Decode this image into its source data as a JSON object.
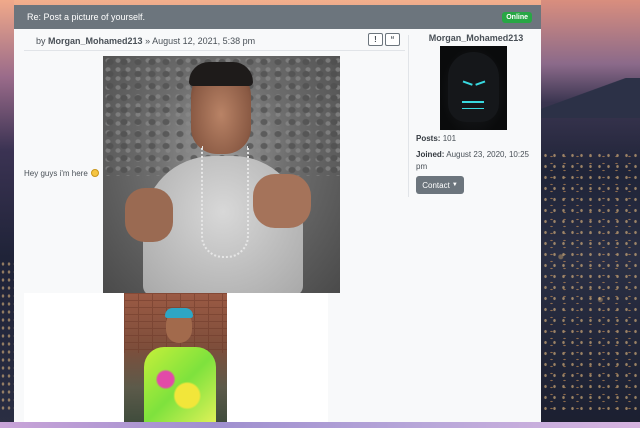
{
  "topic": {
    "title": "Re: Post a picture of yourself.",
    "status_badge": "Online"
  },
  "post": {
    "meta_prefix": "by",
    "author": "Morgan_Mohamed213",
    "meta_date": "» August 12, 2021, 5:38 pm",
    "report_label": "!",
    "quote_label": "“",
    "body_text": "Hey guys i'm here"
  },
  "profile": {
    "username": "Morgan_Mohamed213",
    "posts_label": "Posts:",
    "posts_value": "101",
    "joined_label": "Joined:",
    "joined_value": "August 23, 2020, 10:25 pm",
    "contact_label": "Contact"
  },
  "colors": {
    "header_bg": "#6c757d",
    "online_badge": "#28a745",
    "post_bg": "#f8f9fa"
  }
}
